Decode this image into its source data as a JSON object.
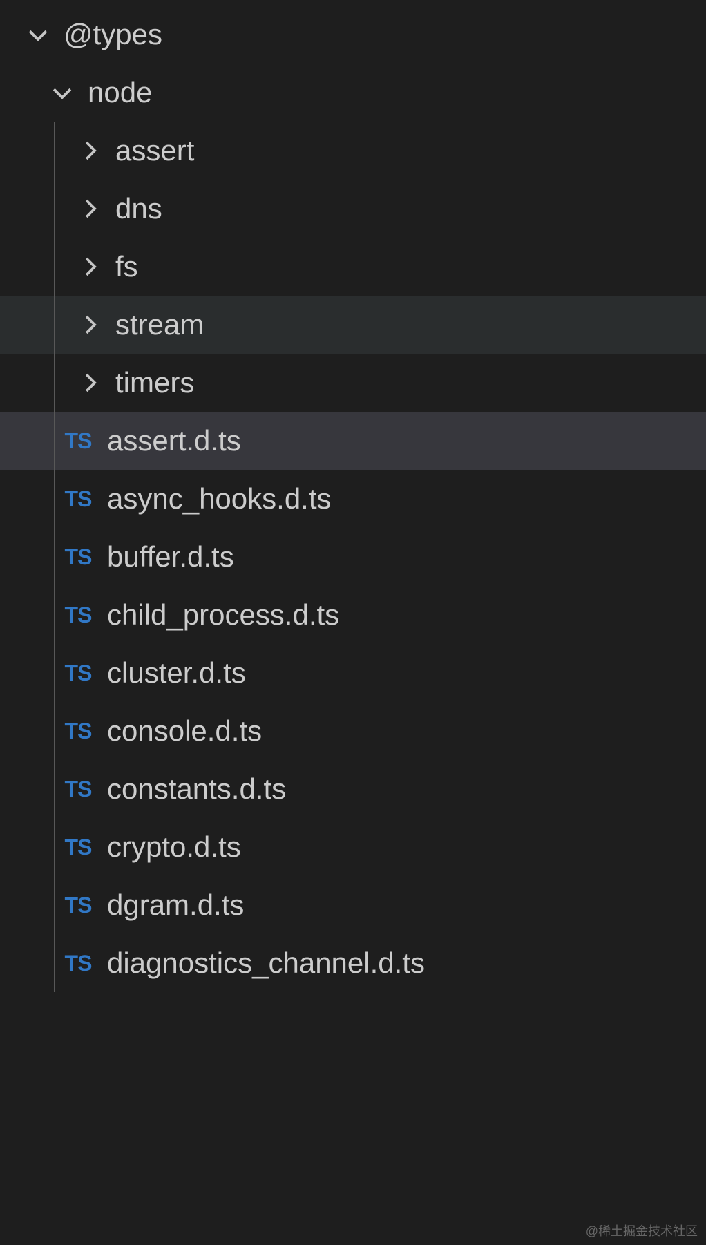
{
  "tree": {
    "root": {
      "label": "@types",
      "expanded": true
    },
    "node": {
      "label": "node",
      "expanded": true
    },
    "folders": [
      {
        "label": "assert",
        "expanded": false,
        "hovered": false
      },
      {
        "label": "dns",
        "expanded": false,
        "hovered": false
      },
      {
        "label": "fs",
        "expanded": false,
        "hovered": false
      },
      {
        "label": "stream",
        "expanded": false,
        "hovered": true
      },
      {
        "label": "timers",
        "expanded": false,
        "hovered": false
      }
    ],
    "files": [
      {
        "label": "assert.d.ts",
        "icon": "TS",
        "selected": true
      },
      {
        "label": "async_hooks.d.ts",
        "icon": "TS",
        "selected": false
      },
      {
        "label": "buffer.d.ts",
        "icon": "TS",
        "selected": false
      },
      {
        "label": "child_process.d.ts",
        "icon": "TS",
        "selected": false
      },
      {
        "label": "cluster.d.ts",
        "icon": "TS",
        "selected": false
      },
      {
        "label": "console.d.ts",
        "icon": "TS",
        "selected": false
      },
      {
        "label": "constants.d.ts",
        "icon": "TS",
        "selected": false
      },
      {
        "label": "crypto.d.ts",
        "icon": "TS",
        "selected": false
      },
      {
        "label": "dgram.d.ts",
        "icon": "TS",
        "selected": false
      },
      {
        "label": "diagnostics_channel.d.ts",
        "icon": "TS",
        "selected": false
      }
    ]
  },
  "watermark": "@稀土掘金技术社区"
}
